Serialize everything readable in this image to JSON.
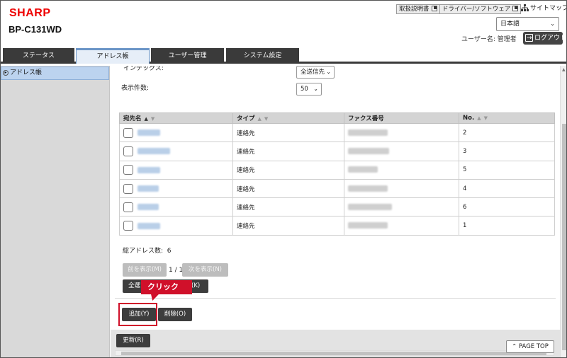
{
  "header": {
    "logo": "SHARP",
    "model": "BP-C131WD",
    "links": {
      "manual": "取扱説明書",
      "driver": "ドライバー/ソフトウェア",
      "sitemap": "サイトマップ"
    },
    "language": "日本語",
    "username": "ユーザー名: 管理者",
    "logout": "ログアウト"
  },
  "tabs": [
    "ステータス",
    "アドレス帳",
    "ユーザー管理",
    "システム設定"
  ],
  "active_tab": 1,
  "sidebar": {
    "items": [
      {
        "label": "アドレス帳"
      }
    ]
  },
  "filters": {
    "index_label": "インデックス:",
    "index_value": "全送信先",
    "count_label": "表示件数:",
    "count_value": "50"
  },
  "table": {
    "columns": [
      "宛先名",
      "タイプ",
      "ファクス番号",
      "No."
    ],
    "rows": [
      {
        "type": "連絡先",
        "no": "2"
      },
      {
        "type": "連絡先",
        "no": "3"
      },
      {
        "type": "連絡先",
        "no": "5"
      },
      {
        "type": "連絡先",
        "no": "4"
      },
      {
        "type": "連絡先",
        "no": "6"
      },
      {
        "type": "連絡先",
        "no": "1"
      }
    ]
  },
  "total": {
    "label": "総アドレス数:",
    "value": "6"
  },
  "pager": {
    "prev": "前を表示(M)",
    "page": "1 / 1",
    "next": "次を表示(N)"
  },
  "buttons": {
    "select_all_prefix": "全選",
    "select_all_suffix": "(K)",
    "add": "追加(Y)",
    "delete": "削除(O)",
    "update": "更新(R)",
    "page_top": "PAGE TOP"
  },
  "annotation": {
    "callout": "クリック"
  },
  "colors": {
    "brand": "#e00000",
    "callout": "#d0102a",
    "tab_dark": "#3a3a3a",
    "selected": "#bcd3ef"
  }
}
